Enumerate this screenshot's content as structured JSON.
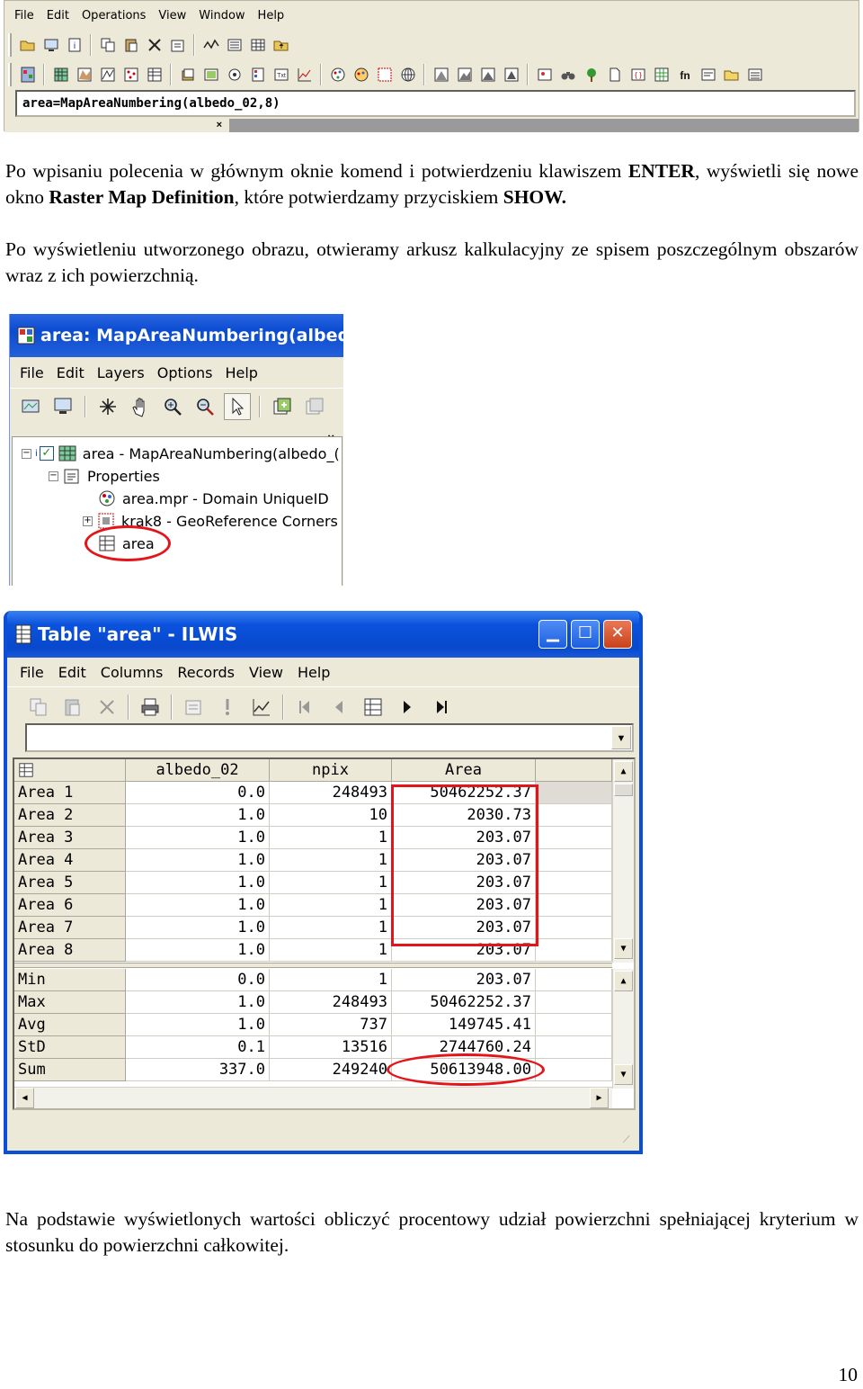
{
  "ilwis_main": {
    "menu": [
      "File",
      "Edit",
      "Operations",
      "View",
      "Window",
      "Help"
    ],
    "command": "area=MapAreaNumbering(albedo_02,8)",
    "close_symbol": "×"
  },
  "paragraphs": {
    "p1_a": "Po wpisaniu polecenia w głównym oknie komend i potwierdzeniu klawiszem ",
    "p1_enter": "ENTER",
    "p1_b": ", wyświetli się nowe okno ",
    "p1_rmd": "Raster Map Definition",
    "p1_c": ", które potwierdzamy przyciskiem ",
    "p1_show": "SHOW.",
    "p2": "Po wyświetleniu utworzonego obrazu, otwieramy arkusz kalkulacyjny ze spisem poszczególnym obszarów wraz z ich powierzchnią.",
    "p3": "Na podstawie wyświetlonych wartości obliczyć procentowy udział powierzchni spełniającej kryterium w stosunku do powierzchni całkowitej."
  },
  "map_window": {
    "title": "area: MapAreaNumbering(albedo_",
    "menu": [
      "File",
      "Edit",
      "Layers",
      "Options",
      "Help"
    ],
    "close_symbol": "×",
    "tree": {
      "root": "area - MapAreaNumbering(albedo_(",
      "properties": "Properties",
      "domain": "area.mpr - Domain UniqueID",
      "georef": "krak8 - GeoReference Corners",
      "table": "area"
    }
  },
  "table_window": {
    "title": "Table \"area\" - ILWIS",
    "menu": [
      "File",
      "Edit",
      "Columns",
      "Records",
      "View",
      "Help"
    ],
    "columns": [
      "albedo_02",
      "npix",
      "Area"
    ],
    "records": [
      {
        "name": "Area 1",
        "albedo": "0.0",
        "npix": "248493",
        "area": "50462252.37"
      },
      {
        "name": "Area 2",
        "albedo": "1.0",
        "npix": "10",
        "area": "2030.73"
      },
      {
        "name": "Area 3",
        "albedo": "1.0",
        "npix": "1",
        "area": "203.07"
      },
      {
        "name": "Area 4",
        "albedo": "1.0",
        "npix": "1",
        "area": "203.07"
      },
      {
        "name": "Area 5",
        "albedo": "1.0",
        "npix": "1",
        "area": "203.07"
      },
      {
        "name": "Area 6",
        "albedo": "1.0",
        "npix": "1",
        "area": "203.07"
      },
      {
        "name": "Area 7",
        "albedo": "1.0",
        "npix": "1",
        "area": "203.07"
      },
      {
        "name": "Area 8",
        "albedo": "1.0",
        "npix": "1",
        "area": "203.07"
      }
    ],
    "stats": [
      {
        "name": "Min",
        "albedo": "0.0",
        "npix": "1",
        "area": "203.07"
      },
      {
        "name": "Max",
        "albedo": "1.0",
        "npix": "248493",
        "area": "50462252.37"
      },
      {
        "name": "Avg",
        "albedo": "1.0",
        "npix": "737",
        "area": "149745.41"
      },
      {
        "name": "StD",
        "albedo": "0.1",
        "npix": "13516",
        "area": "2744760.24"
      },
      {
        "name": "Sum",
        "albedo": "337.0",
        "npix": "249240",
        "area": "50613948.00"
      }
    ]
  },
  "page_number": "10",
  "colors": {
    "highlight": "#e3151a",
    "xp_title": "#0a4bd0",
    "window_bg": "#ece9d8"
  }
}
